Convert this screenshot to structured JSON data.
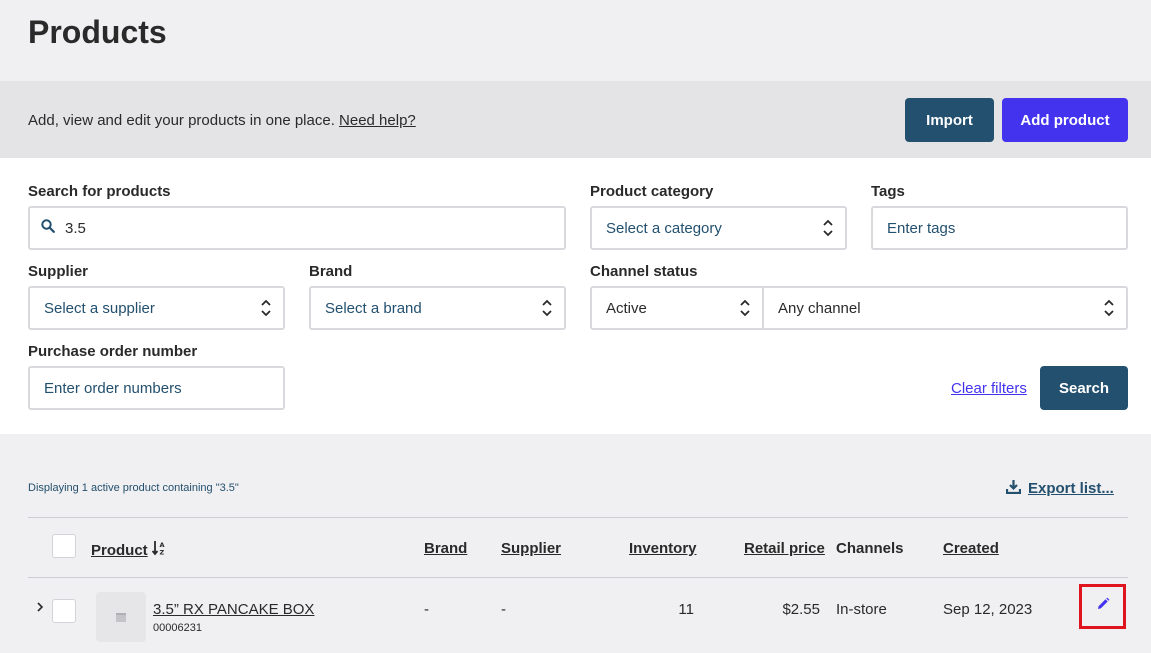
{
  "header": {
    "title": "Products"
  },
  "banner": {
    "text": "Add, view and edit your products in one place.",
    "help_link": "Need help?",
    "import_label": "Import",
    "add_label": "Add product"
  },
  "filters": {
    "search": {
      "label": "Search for products",
      "value": "3.5"
    },
    "category": {
      "label": "Product category",
      "placeholder": "Select a category"
    },
    "tags": {
      "label": "Tags",
      "placeholder": "Enter tags"
    },
    "supplier": {
      "label": "Supplier",
      "placeholder": "Select a supplier"
    },
    "brand": {
      "label": "Brand",
      "placeholder": "Select a brand"
    },
    "channel_status": {
      "label": "Channel status",
      "status_value": "Active",
      "channel_value": "Any channel"
    },
    "purchase_order": {
      "label": "Purchase order number",
      "placeholder": "Enter order numbers"
    },
    "clear_label": "Clear filters",
    "search_label": "Search"
  },
  "results": {
    "summary": "Displaying 1 active product containing \"3.5\"",
    "export_label": "Export list...",
    "columns": {
      "product": "Product",
      "brand": "Brand",
      "supplier": "Supplier",
      "inventory": "Inventory",
      "retail_price": "Retail price",
      "channels": "Channels",
      "created": "Created"
    },
    "rows": [
      {
        "name": "3.5” RX PANCAKE BOX",
        "sku": "00006231",
        "brand": "-",
        "supplier": "-",
        "inventory": "11",
        "retail_price": "$2.55",
        "channels": "In-store",
        "created": "Sep 12, 2023"
      }
    ]
  },
  "colors": {
    "primary_dark": "#23506e",
    "accent": "#4433ee",
    "highlight": "#e0141e"
  },
  "icons": [
    "search-icon",
    "spinner-icon",
    "download-icon",
    "sort-az-icon",
    "chevron-right-icon",
    "image-placeholder-icon",
    "pencil-icon"
  ]
}
